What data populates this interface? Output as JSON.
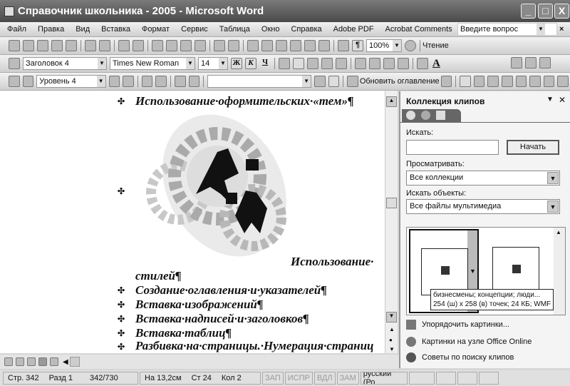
{
  "window": {
    "title": "Справочник школьника - 2005 - Microsoft Word",
    "controls": [
      "_",
      "□",
      "X"
    ]
  },
  "menu": {
    "items": [
      "Файл",
      "Правка",
      "Вид",
      "Вставка",
      "Формат",
      "Сервис",
      "Таблица",
      "Окно",
      "Справка",
      "Adobe PDF",
      "Acrobat Comments"
    ],
    "help_placeholder": "Введите вопрос",
    "close": "×"
  },
  "standard_toolbar": {
    "zoom": "100%",
    "reading": "Чтение",
    "pilcrow": "¶"
  },
  "format_toolbar": {
    "style": "Заголовок 4",
    "font": "Times New Roman",
    "size": "14",
    "bold": "Ж",
    "italic": "К",
    "underline": "Ч",
    "font_color": "A"
  },
  "outline_toolbar": {
    "level": "Уровень 4",
    "update_toc": "Обновить оглавление"
  },
  "document": {
    "lines": [
      "Использование·оформительских·«тем»¶",
      "Использование·",
      "стилей¶",
      "Создание·оглавления·и·указателей¶",
      "Вставка·изображений¶",
      "Вставка·надписей·и·заголовков¶",
      "Вставка·таблиц¶",
      "Разбивка·на·страницы.·Нумерация·страниц"
    ],
    "bullet": "✣"
  },
  "task_pane": {
    "title": "Коллекция клипов",
    "search_label": "Искать:",
    "search_value": "",
    "search_button": "Начать",
    "browse_label": "Просматривать:",
    "browse_value": "Все коллекции",
    "type_label": "Искать объекты:",
    "type_value": "Все файлы мультимедиа",
    "tooltip": [
      "бизнесмены; концепции; люди...",
      "254 (ш) x 258 (в) точек; 24 КБ; WMF"
    ],
    "links": [
      "Упорядочить картинки...",
      "Картинки на узле Office Online",
      "Советы по поиску клипов"
    ]
  },
  "status": {
    "page": "Стр. 342",
    "section": "Разд 1",
    "pages": "342/730",
    "at": "На 13,2см",
    "line": "Ст 24",
    "col": "Кол 2",
    "modes": [
      "ЗАП",
      "ИСПР",
      "ВДЛ",
      "ЗАМ"
    ],
    "language": "русский (Ро"
  }
}
